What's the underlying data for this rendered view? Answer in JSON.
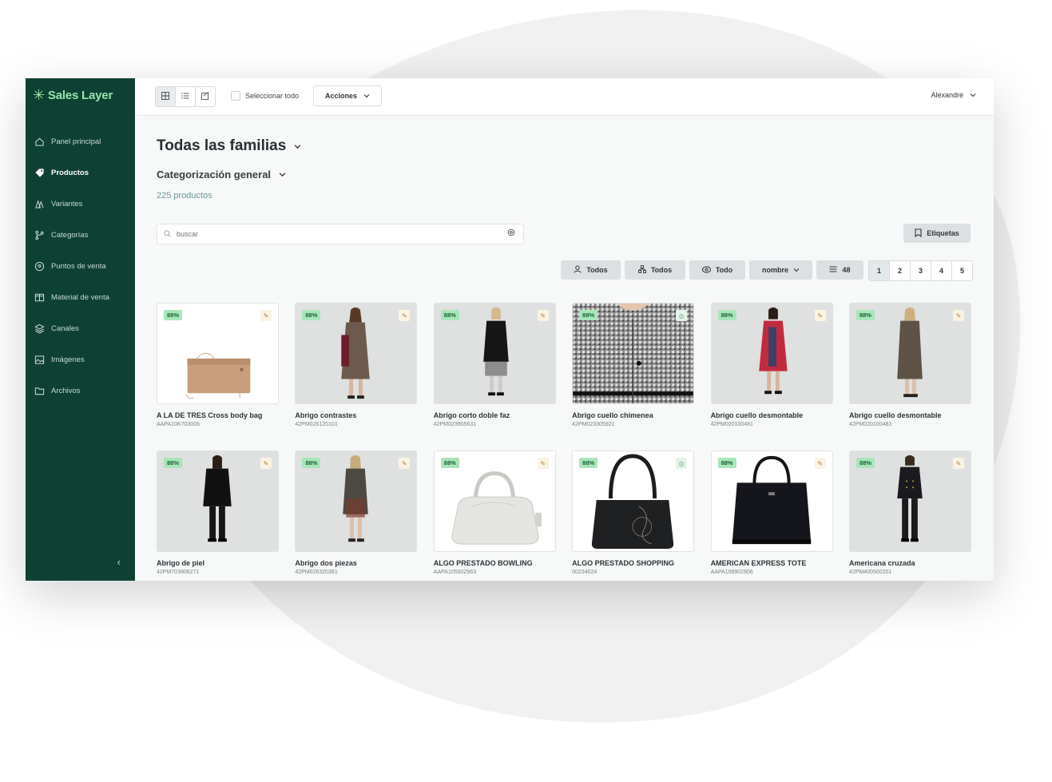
{
  "brand": {
    "name": "Sales Layer",
    "accent": "#9be3a9",
    "sidebar_bg": "#0f4034"
  },
  "sidebar": {
    "items": [
      {
        "label": "Panel principal",
        "icon": "home-icon",
        "active": false
      },
      {
        "label": "Productos",
        "icon": "tag-icon",
        "active": true
      },
      {
        "label": "Variantes",
        "icon": "variants-icon",
        "active": false
      },
      {
        "label": "Categorías",
        "icon": "branch-icon",
        "active": false
      },
      {
        "label": "Puntos de venta",
        "icon": "location-pin-icon",
        "active": false
      },
      {
        "label": "Material de venta",
        "icon": "book-open-icon",
        "active": false
      },
      {
        "label": "Canales",
        "icon": "layers-icon",
        "active": false
      },
      {
        "label": "Imágenes",
        "icon": "image-icon",
        "active": false
      },
      {
        "label": "Archivos",
        "icon": "folder-icon",
        "active": false
      }
    ],
    "collapse_icon": "chevron-left-icon"
  },
  "topbar": {
    "select_all": "Seleccionar todo",
    "actions_label": "Acciones",
    "user_name": "Alexandre"
  },
  "main": {
    "title": "Todas las familias",
    "subtitle": "Categorización general",
    "count": "225 productos",
    "search_placeholder": "buscar",
    "tags_label": "Etiquetas",
    "filters": {
      "users": "Todos",
      "families": "Todos",
      "visibility": "Todo",
      "sort": "nombre",
      "per_page": "48"
    },
    "pages": [
      "1",
      "2",
      "3",
      "4",
      "5"
    ],
    "current_page": "1"
  },
  "products": [
    {
      "name": "A LA DE TRES Cross body bag",
      "code": "AAPA10K703006",
      "completeness": "88%",
      "action_icon": "edit-icon"
    },
    {
      "name": "Abrigo contrastes",
      "code": "42PM026120101",
      "completeness": "88%",
      "action_icon": "edit-icon"
    },
    {
      "name": "Abrigo corto doble faz",
      "code": "42PM023905631",
      "completeness": "88%",
      "action_icon": "edit-icon"
    },
    {
      "name": "Abrigo cuello chimenea",
      "code": "42PM023305921",
      "completeness": "88%",
      "action_icon": "eye-icon"
    },
    {
      "name": "Abrigo cuello desmontable",
      "code": "42PM020100481",
      "completeness": "88%",
      "action_icon": "edit-icon"
    },
    {
      "name": "Abrigo cuello desmontable",
      "code": "42PM020100483",
      "completeness": "88%",
      "action_icon": "edit-icon"
    },
    {
      "name": "Abrigo de piel",
      "code": "42PM703906271",
      "completeness": "88%",
      "action_icon": "edit-icon"
    },
    {
      "name": "Abrigo dos piezas",
      "code": "42PM026320361",
      "completeness": "88%",
      "action_icon": "edit-icon"
    },
    {
      "name": "ALGO PRESTADO BOWLING",
      "code": "AAPA105502963",
      "completeness": "88%",
      "action_icon": "edit-icon"
    },
    {
      "name": "ALGO PRESTADO SHOPPING",
      "code": "00234024",
      "completeness": "88%",
      "action_icon": "eye-icon"
    },
    {
      "name": "AMERICAN EXPRESS TOTE",
      "code": "AAPA108902806",
      "completeness": "88%",
      "action_icon": "edit-icon"
    },
    {
      "name": "Americana cruzada",
      "code": "42PM400500201",
      "completeness": "88%",
      "action_icon": "edit-icon"
    }
  ]
}
